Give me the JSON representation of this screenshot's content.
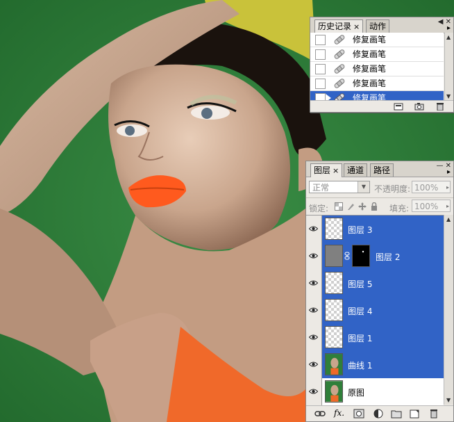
{
  "history_panel": {
    "tabs": [
      {
        "label": "历史记录",
        "close": "×",
        "active": true
      },
      {
        "label": "动作",
        "active": false
      }
    ],
    "window_controls": "◀ ✕",
    "menu_arrow": "▸",
    "items": [
      {
        "label": "修复画笔",
        "icon": "healing-brush-icon",
        "selected": false
      },
      {
        "label": "修复画笔",
        "icon": "healing-brush-icon",
        "selected": false
      },
      {
        "label": "修复画笔",
        "icon": "healing-brush-icon",
        "selected": false
      },
      {
        "label": "修复画笔",
        "icon": "healing-brush-icon",
        "selected": false
      },
      {
        "label": "修复画笔",
        "icon": "healing-brush-icon",
        "selected": true
      }
    ],
    "bottom_buttons": [
      "new-document-from-state-icon",
      "snapshot-camera-icon",
      "trash-icon"
    ]
  },
  "layers_panel": {
    "tabs": [
      {
        "label": "图层",
        "close": "×",
        "active": true
      },
      {
        "label": "通道",
        "active": false
      },
      {
        "label": "路径",
        "active": false
      }
    ],
    "window_controls": "— ✕",
    "menu_arrow": "▸",
    "blend_mode": "正常",
    "opacity_label": "不透明度:",
    "opacity_value": "100%",
    "lock_label": "锁定:",
    "fill_label": "填充:",
    "fill_value": "100%",
    "layers": [
      {
        "name": "图层 3",
        "thumb": "transparent",
        "selected": true,
        "visible": true
      },
      {
        "name": "图层 2",
        "thumb": "gray-with-mask",
        "selected": true,
        "visible": true
      },
      {
        "name": "图层 5",
        "thumb": "transparent",
        "selected": true,
        "visible": true
      },
      {
        "name": "图层 4",
        "thumb": "transparent",
        "selected": true,
        "visible": true
      },
      {
        "name": "图层 1",
        "thumb": "transparent",
        "selected": true,
        "visible": true
      },
      {
        "name": "曲线 1",
        "thumb": "photo",
        "selected": true,
        "visible": true
      },
      {
        "name": "原图",
        "thumb": "photo",
        "selected": false,
        "visible": true
      }
    ],
    "fx_label": "fx.",
    "bottom_buttons": [
      "link-layers-icon",
      "fx-icon",
      "add-mask-icon",
      "adjustment-layer-icon",
      "new-group-icon",
      "new-layer-icon",
      "trash-icon"
    ]
  },
  "colors": {
    "selection": "#3163c6",
    "panel_bg": "#ece9e4",
    "background_green": "#2f7f3a",
    "lips": "#ff5a1e"
  }
}
